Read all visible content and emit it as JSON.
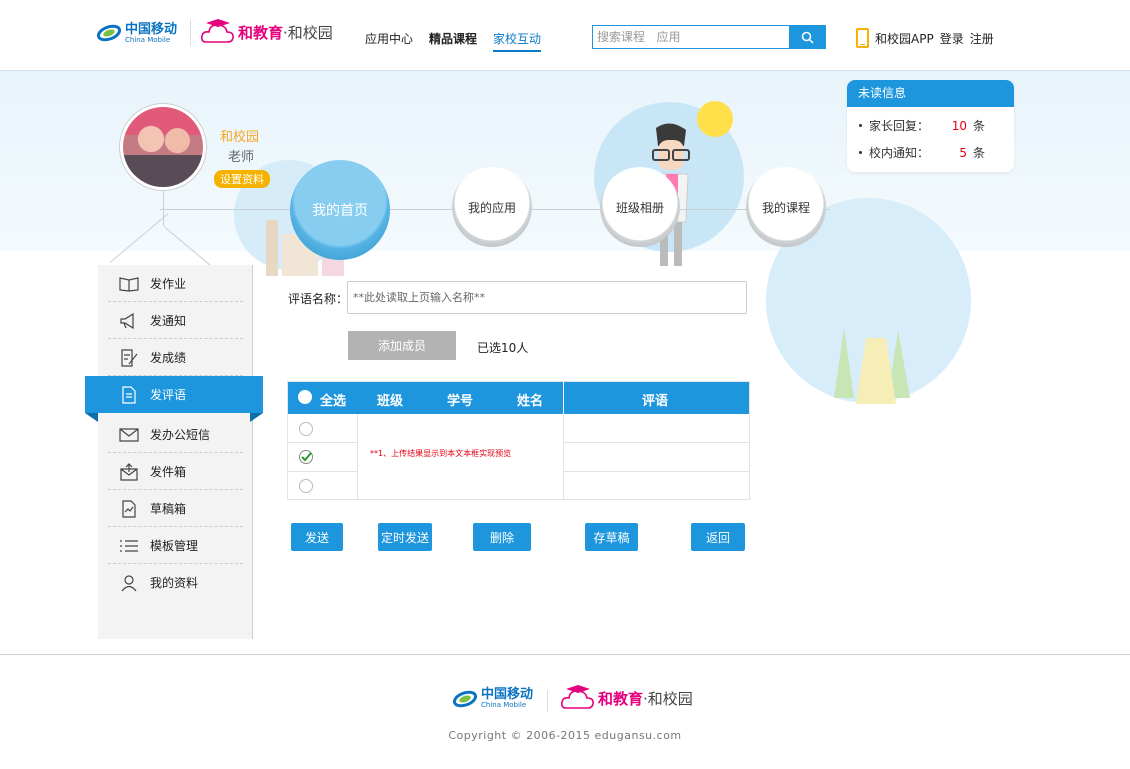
{
  "header": {
    "logo_cm_cn": "中国移动",
    "logo_cm_en": "China Mobile",
    "logo_he_main": "和教育",
    "logo_he_dot": "·",
    "logo_he_sub": "和校园",
    "nav": [
      {
        "label": "应用中心"
      },
      {
        "label": "精品课程"
      },
      {
        "label": "家校互动"
      }
    ],
    "search_placeholder": "搜索课程   应用",
    "app_label": "和校园APP",
    "login": "登录",
    "register": "注册"
  },
  "profile": {
    "name": "和校园",
    "role": "老师",
    "settings": "设置资料"
  },
  "circle_nav": [
    "我的首页",
    "我的应用",
    "班级相册",
    "我的课程"
  ],
  "unread": {
    "title": "未读信息",
    "items": [
      {
        "label": "家长回复：",
        "count": "10",
        "unit": "条"
      },
      {
        "label": "校内通知：",
        "count": "5",
        "unit": "条"
      }
    ]
  },
  "sidebar": {
    "items": [
      {
        "label": "发作业",
        "icon": "book-icon"
      },
      {
        "label": "发通知",
        "icon": "megaphone-icon"
      },
      {
        "label": "发成绩",
        "icon": "edit-doc-icon"
      },
      {
        "label": "发评语",
        "icon": "document-icon"
      },
      {
        "label": "发办公短信",
        "icon": "envelope-icon"
      },
      {
        "label": "发件箱",
        "icon": "outbox-icon"
      },
      {
        "label": "草稿箱",
        "icon": "draft-icon"
      },
      {
        "label": "模板管理",
        "icon": "list-icon"
      },
      {
        "label": "我的资料",
        "icon": "user-icon"
      }
    ],
    "active_index": 3
  },
  "form": {
    "name_label": "评语名称：",
    "name_placeholder": "**此处读取上页输入名称**",
    "add_member": "添加成员",
    "selected_count": "已选10人"
  },
  "table": {
    "select_all": "全选",
    "headers": [
      "班级",
      "学号",
      "姓名",
      "评语"
    ],
    "note": "**1、上传结果显示到本文本框实现预览"
  },
  "actions": [
    "发送",
    "定时发送",
    "删除",
    "存草稿",
    "返回"
  ],
  "footer": {
    "copyright": "Copyright © 2006-2015   edugansu.com"
  },
  "colors": {
    "primary": "#1e96de",
    "accent_orange": "#f5b200",
    "brand_pink": "#e5007e",
    "alert_red": "#e60012"
  }
}
